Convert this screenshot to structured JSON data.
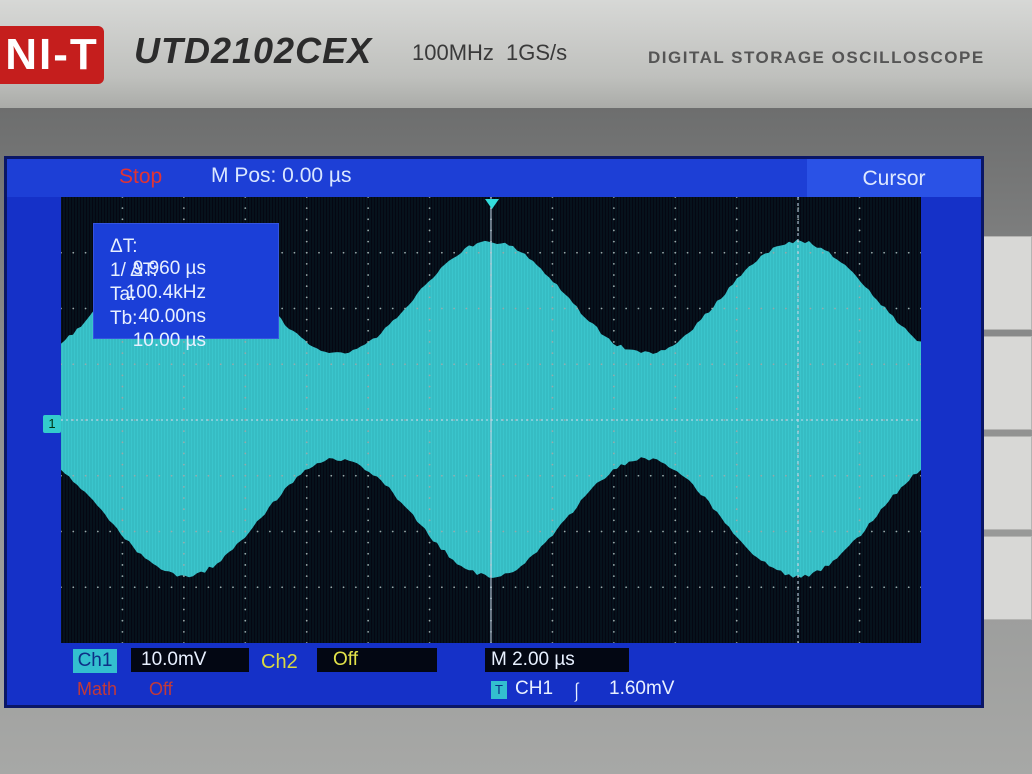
{
  "brand": {
    "logo": "NI-T",
    "model": "UTD2102CEX",
    "specs": "100MHz  1GS/s",
    "description": "DIGITAL STORAGE OSCILLOSCOPE"
  },
  "status": {
    "run_state": "Stop",
    "m_pos": "M Pos: 0.00 µs",
    "menu": "Cursor"
  },
  "measurements": [
    {
      "label": "ΔT:",
      "value": "9.960 µs"
    },
    {
      "label": "1/ ΔT:",
      "value": "100.4kHz"
    },
    {
      "label": "Ta:",
      "value": "40.00ns"
    },
    {
      "label": "Tb:",
      "value": "10.00 µs"
    }
  ],
  "channel_marker": "1",
  "bottom": {
    "ch1_label": "Ch1",
    "ch1_scale": "10.0mV",
    "ch2_label": "Ch2",
    "ch2_state": "Off",
    "timebase": "M 2.00 µs",
    "math_label": "Math",
    "math_state": "Off",
    "trigger_tag": "T",
    "trigger_source": "CH1",
    "trigger_edge": "⎰",
    "trigger_level": "1.60mV"
  },
  "colors": {
    "trace": "#3fd6dc",
    "lcd": "#1531c8",
    "grid_bg": "#050712",
    "stop": "#e23333",
    "ch2": "#d9d940"
  },
  "waveform": {
    "type": "am_envelope",
    "upper_max_div": 3.2,
    "upper_min_div": 1.2,
    "lower_max_div": -0.7,
    "lower_min_div": -2.8,
    "envelope_period_div": 5
  }
}
